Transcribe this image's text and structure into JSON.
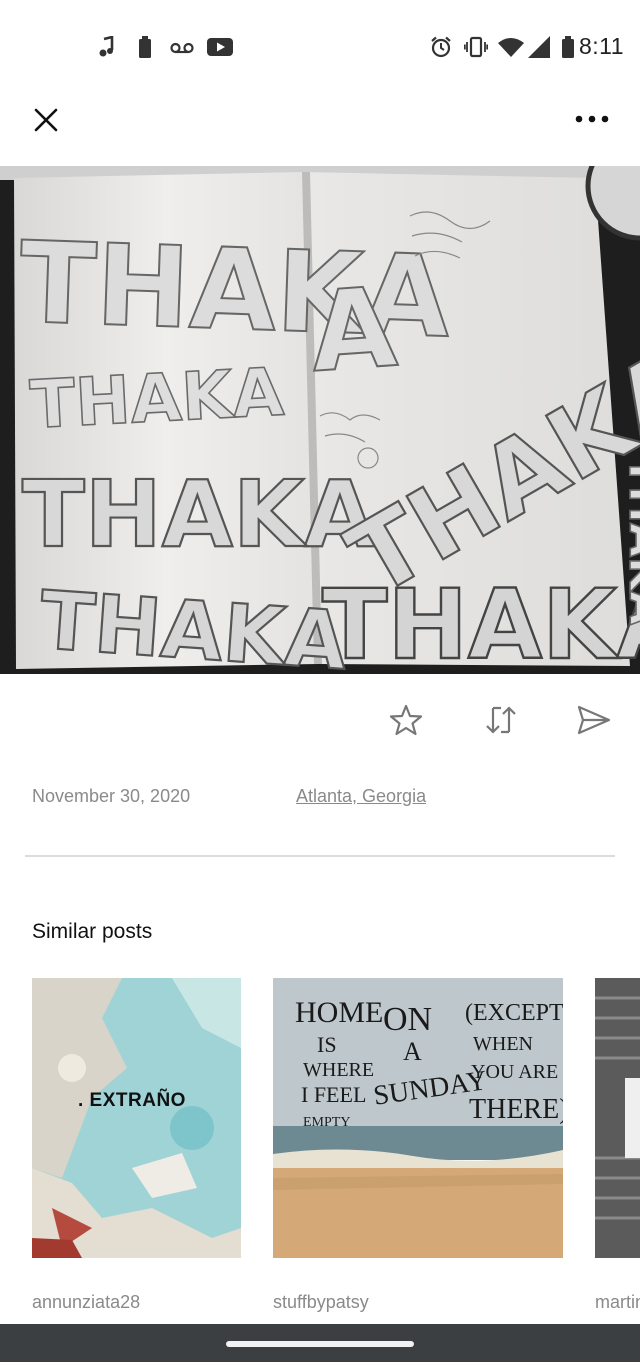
{
  "status_bar": {
    "time": "8:11",
    "left_icons": [
      "music-note-icon",
      "battery-saver-icon",
      "voicemail-icon",
      "youtube-icon"
    ],
    "right_icons": [
      "alarm-icon",
      "vibrate-icon",
      "wifi-icon",
      "signal-icon",
      "battery-icon"
    ]
  },
  "toolbar": {
    "close_icon": "close-icon",
    "more_icon": "more-horizontal-icon"
  },
  "photo": {
    "lettering": "THAKA"
  },
  "actions": {
    "favorite_icon": "star-icon",
    "repost_icon": "repost-icon",
    "share_icon": "send-icon"
  },
  "post": {
    "date": "November 30, 2020",
    "location": "Atlanta, Georgia"
  },
  "similar": {
    "title": "Similar posts",
    "items": [
      {
        "user": "annunziata28",
        "image_text": ". EXTRAÑO"
      },
      {
        "user": "stuffbypatsy",
        "image_text": [
          "HOME",
          "ON",
          "(EXCEPT",
          "IS",
          "A",
          "WHEN",
          "WHERE",
          "SUNDAY",
          "YOU ARE",
          "I FEEL",
          "THERE)",
          "EMPTY"
        ]
      },
      {
        "user": "martinez"
      }
    ]
  },
  "colors": {
    "divider": "#dcdcdc",
    "muted_text": "#8a8a8a",
    "nav_bar": "#3b3f41"
  }
}
